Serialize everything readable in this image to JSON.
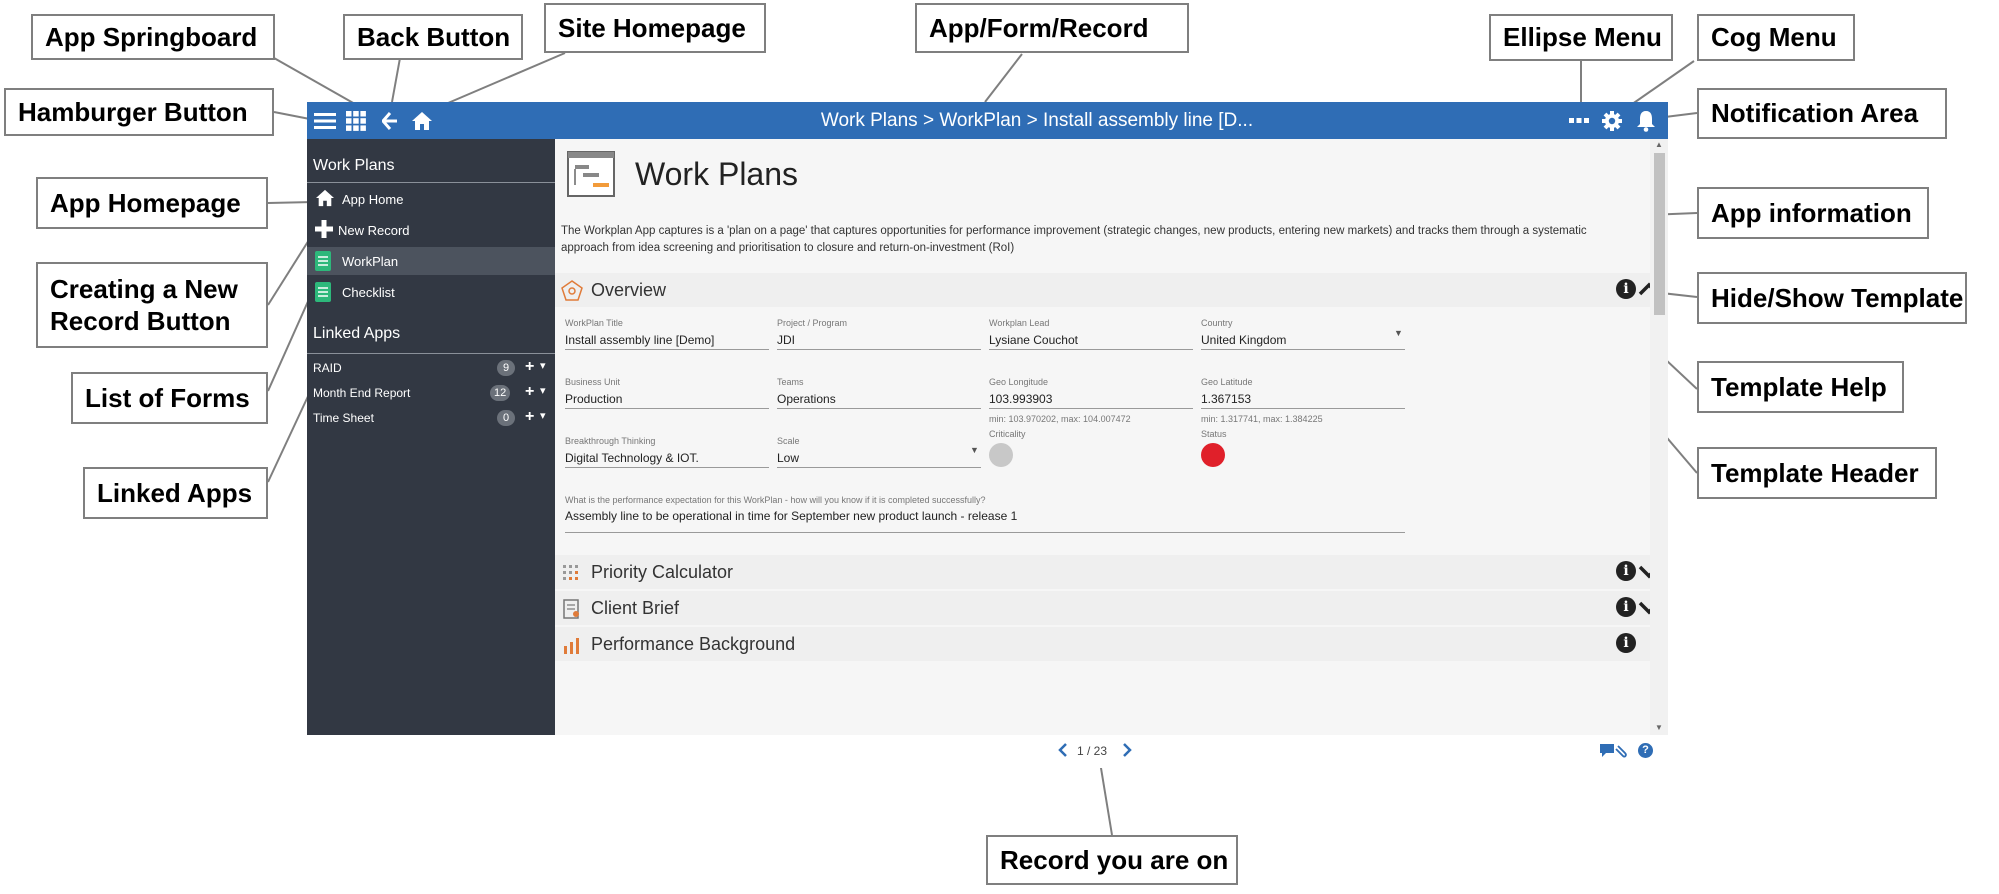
{
  "callouts": {
    "app_springboard": "App Springboard",
    "back_button": "Back Button",
    "site_homepage": "Site Homepage",
    "app_form_record": "App/Form/Record",
    "ellipse_menu": "Ellipse Menu",
    "cog_menu": "Cog Menu",
    "hamburger_button": "Hamburger Button",
    "notification_area": "Notification Area",
    "app_homepage": "App Homepage",
    "app_information": "App information",
    "creating_new_record": "Creating a New Record Button",
    "hide_show_template": "Hide/Show Template",
    "template_help": "Template Help",
    "list_of_forms": "List of Forms",
    "template_header": "Template Header",
    "linked_apps": "Linked Apps",
    "record_you_are_on": "Record you are on"
  },
  "topbar": {
    "breadcrumb": "Work Plans > WorkPlan > Install assembly line [D..."
  },
  "sidebar": {
    "app_name": "Work Plans",
    "items": [
      {
        "label": "App Home",
        "icon": "home-icon"
      },
      {
        "label": "New Record",
        "icon": "plus-icon"
      },
      {
        "label": "WorkPlan",
        "icon": "form-icon"
      },
      {
        "label": "Checklist",
        "icon": "form-icon"
      }
    ],
    "linked_heading": "Linked Apps",
    "linked_apps": [
      {
        "label": "RAID",
        "count": "9"
      },
      {
        "label": "Month End Report",
        "count": "12"
      },
      {
        "label": "Time Sheet",
        "count": "0"
      }
    ]
  },
  "main": {
    "title": "Work Plans",
    "description": "The Workplan App captures is a 'plan on a page' that captures opportunities for performance improvement (strategic changes, new products, entering new markets) and tracks them through a systematic approach from idea screening and prioritisation to closure and return-on-investment (RoI)",
    "overview": {
      "title": "Overview",
      "workplan_title": {
        "label": "WorkPlan Title",
        "value": "Install assembly line [Demo]"
      },
      "project_program": {
        "label": "Project / Program",
        "value": "JDI"
      },
      "workplan_lead": {
        "label": "Workplan Lead",
        "value": "Lysiane Couchot"
      },
      "country": {
        "label": "Country",
        "value": "United Kingdom"
      },
      "business_unit": {
        "label": "Business Unit",
        "value": "Production"
      },
      "teams": {
        "label": "Teams",
        "value": "Operations"
      },
      "geo_longitude": {
        "label": "Geo Longitude",
        "value": "103.993903",
        "hint": "min: 103.970202, max: 104.007472"
      },
      "geo_latitude": {
        "label": "Geo Latitude",
        "value": "1.367153",
        "hint": "min: 1.317741, max: 1.384225"
      },
      "breakthrough": {
        "label": "Breakthrough Thinking",
        "value": "Digital Technology & IOT."
      },
      "scale": {
        "label": "Scale",
        "value": "Low"
      },
      "criticality": {
        "label": "Criticality",
        "color": "#c8c8c8"
      },
      "status": {
        "label": "Status",
        "color": "#e0202a"
      },
      "expectation": {
        "label": "What is the performance expectation for this WorkPlan - how will you know if it is completed successfully?",
        "value": "Assembly line to be operational in time for September new product launch - release 1"
      }
    },
    "sections": [
      {
        "title": "Priority Calculator"
      },
      {
        "title": "Client Brief"
      },
      {
        "title": "Performance Background"
      }
    ]
  },
  "pager": {
    "position": "1 / 23"
  }
}
